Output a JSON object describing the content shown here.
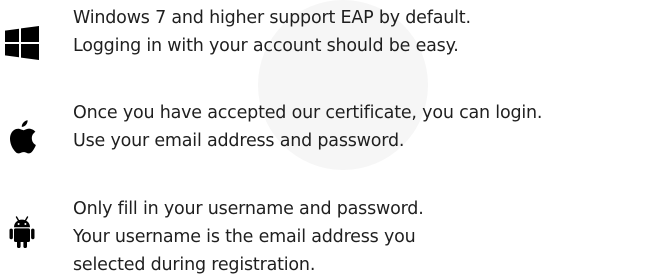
{
  "colors": {
    "text": "#1f1f1f",
    "icon": "#000000",
    "watermark": "#f6f6f6"
  },
  "platforms": [
    {
      "icon": "windows-logo-icon",
      "lines": [
        "Windows 7 and higher support EAP by default.",
        "Logging in with your account should be easy."
      ]
    },
    {
      "icon": "apple-logo-icon",
      "lines": [
        "Once you have accepted our certificate, you can login.",
        "Use your email address and password."
      ]
    },
    {
      "icon": "android-logo-icon",
      "lines": [
        "Only fill in your username and password.",
        "Your username is the email address you",
        "selected during registration."
      ]
    }
  ]
}
